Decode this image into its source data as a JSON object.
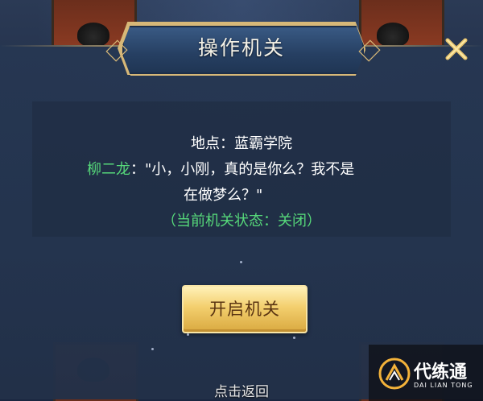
{
  "dialog": {
    "title": "操作机关",
    "location_line": "地点：蓝霸学院",
    "speaker": "柳二龙",
    "speech_line_1": "：\"小，小刚，真的是你么？我不是",
    "speech_line_2": "在做梦么？\"",
    "status_line": "（当前机关状态：关闭）",
    "open_button_label": "开启机关",
    "close_icon": "close-icon"
  },
  "footer": {
    "return_hint": "点击返回"
  },
  "brand": {
    "name": "代练通",
    "subtitle": "DAI LIAN TONG"
  },
  "colors": {
    "speaker": "#56d97a",
    "status": "#56d97a",
    "title_text": "#f4f1e6",
    "button_gold": "#f3cf6e",
    "frame_gold": "#d7b878"
  }
}
